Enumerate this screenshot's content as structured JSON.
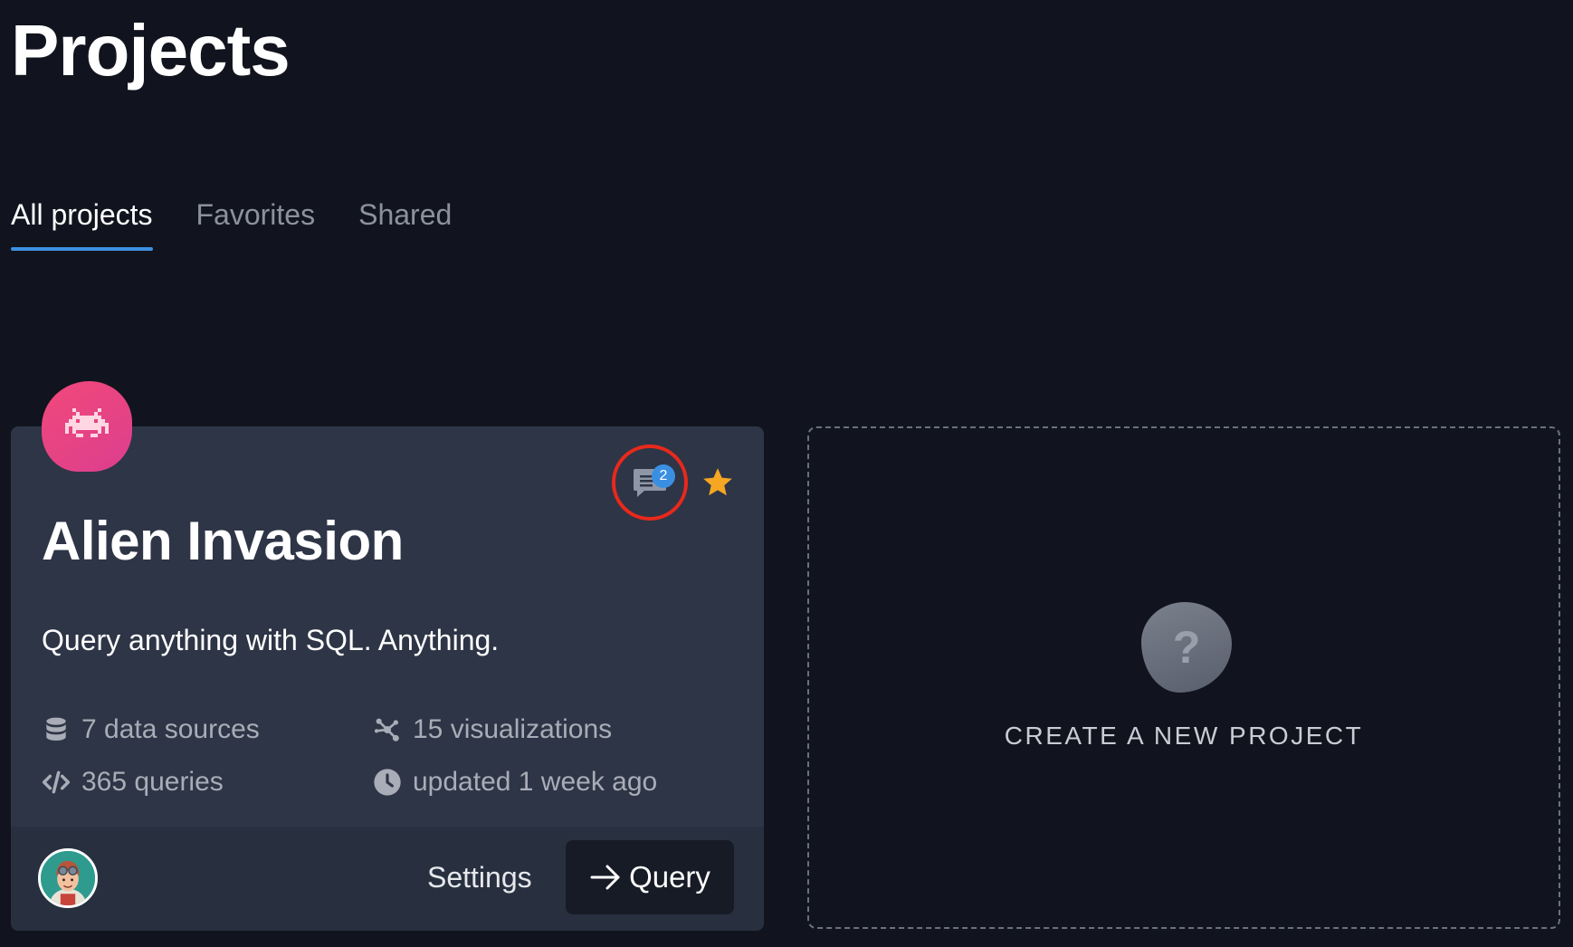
{
  "page": {
    "title": "Projects"
  },
  "tabs": [
    {
      "label": "All projects",
      "active": true
    },
    {
      "label": "Favorites",
      "active": false
    },
    {
      "label": "Shared",
      "active": false
    }
  ],
  "project_card": {
    "title": "Alien Invasion",
    "description": "Query anything with SQL. Anything.",
    "comment_count": "2",
    "favorited": true,
    "stats": {
      "data_sources": "7 data sources",
      "visualizations": "15 visualizations",
      "queries": "365 queries",
      "updated": "updated 1 week ago"
    },
    "settings_label": "Settings",
    "query_label": "Query"
  },
  "new_project": {
    "label": "CREATE A NEW PROJECT",
    "icon_glyph": "?"
  },
  "colors": {
    "background": "#11141e",
    "card": "#2e3546",
    "accent": "#3d8fe0",
    "logo_pink": "#f2487a",
    "star": "#f5a623",
    "highlight_ring": "#e8291c"
  }
}
